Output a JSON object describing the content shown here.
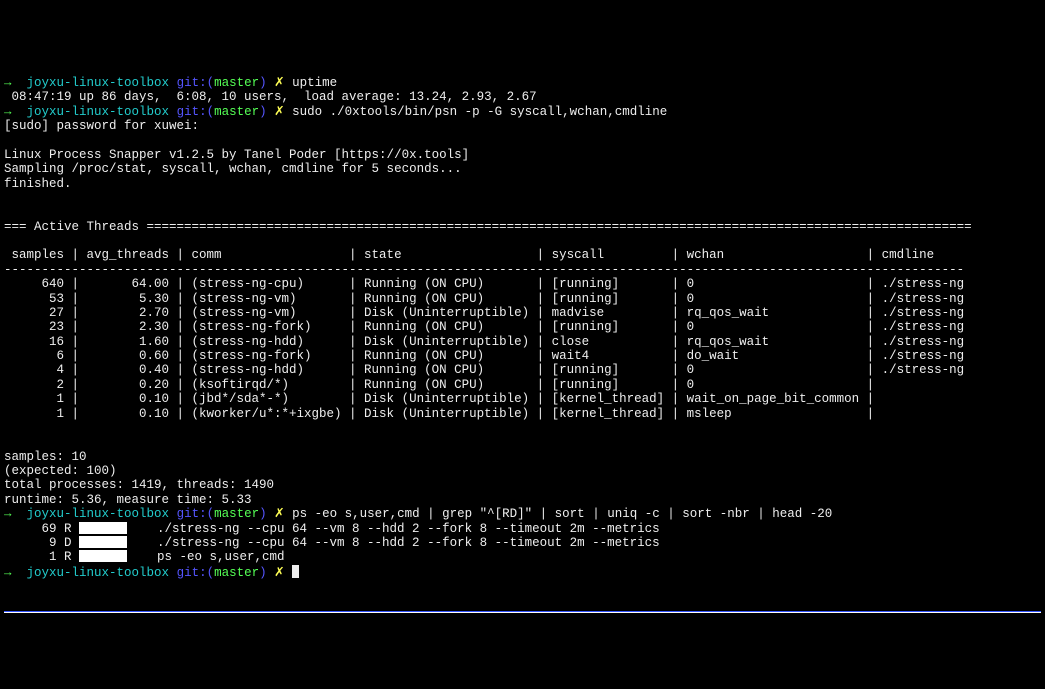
{
  "prompt": {
    "arrow": "→",
    "host": "joyxu-linux-toolbox",
    "git_prefix": "git:(",
    "branch": "master",
    "git_suffix": ")",
    "dirty": "✗"
  },
  "cmd1": "uptime",
  "uptime_out": " 08:47:19 up 86 days,  6:08, 10 users,  load average: 13.24, 2.93, 2.67",
  "cmd2": "sudo ./0xtools/bin/psn -p -G syscall,wchan,cmdline",
  "sudo_prompt": "[sudo] password for xuwei:",
  "psn_hdr1": "Linux Process Snapper v1.2.5 by Tanel Poder [https://0x.tools]",
  "psn_hdr2": "Sampling /proc/stat, syscall, wchan, cmdline for 5 seconds...",
  "psn_hdr3": "finished.",
  "active_hdr": "=== Active Threads ==============================================================================================================",
  "table_header": " samples | avg_threads | comm                 | state                  | syscall         | wchan                   | cmdline",
  "divider": "--------------------------------------------------------------------------------------------------------------------------------",
  "rows": [
    "     640 |       64.00 | (stress-ng-cpu)      | Running (ON CPU)       | [running]       | 0                       | ./stress-ng",
    "      53 |        5.30 | (stress-ng-vm)       | Running (ON CPU)       | [running]       | 0                       | ./stress-ng",
    "      27 |        2.70 | (stress-ng-vm)       | Disk (Uninterruptible) | madvise         | rq_qos_wait             | ./stress-ng",
    "      23 |        2.30 | (stress-ng-fork)     | Running (ON CPU)       | [running]       | 0                       | ./stress-ng",
    "      16 |        1.60 | (stress-ng-hdd)      | Disk (Uninterruptible) | close           | rq_qos_wait             | ./stress-ng",
    "       6 |        0.60 | (stress-ng-fork)     | Running (ON CPU)       | wait4           | do_wait                 | ./stress-ng",
    "       4 |        0.40 | (stress-ng-hdd)      | Running (ON CPU)       | [running]       | 0                       | ./stress-ng",
    "       2 |        0.20 | (ksoftirqd/*)        | Running (ON CPU)       | [running]       | 0                       |",
    "       1 |        0.10 | (jbd*/sda*-*)        | Disk (Uninterruptible) | [kernel_thread] | wait_on_page_bit_common |",
    "       1 |        0.10 | (kworker/u*:*+ixgbe) | Disk (Uninterruptible) | [kernel_thread] | msleep                  |"
  ],
  "footer1": "samples: 10",
  "footer2": "(expected: 100)",
  "footer3": "total processes: 1419, threads: 1490",
  "footer4": "runtime: 5.36, measure time: 5.33",
  "cmd3": "ps -eo s,user,cmd | grep \"^[RD]\" | sort | uniq -c | sort -nbr | head -20",
  "ps_lines": [
    {
      "pre": "     69 R ",
      "redact": true,
      "post": "    ./stress-ng --cpu 64 --vm 8 --hdd 2 --fork 8 --timeout 2m --metrics"
    },
    {
      "pre": "      9 D ",
      "redact": true,
      "post": "    ./stress-ng --cpu 64 --vm 8 --hdd 2 --fork 8 --timeout 2m --metrics"
    },
    {
      "pre": "      1 R ",
      "redact": true,
      "post": "    ps -eo s,user,cmd"
    }
  ]
}
